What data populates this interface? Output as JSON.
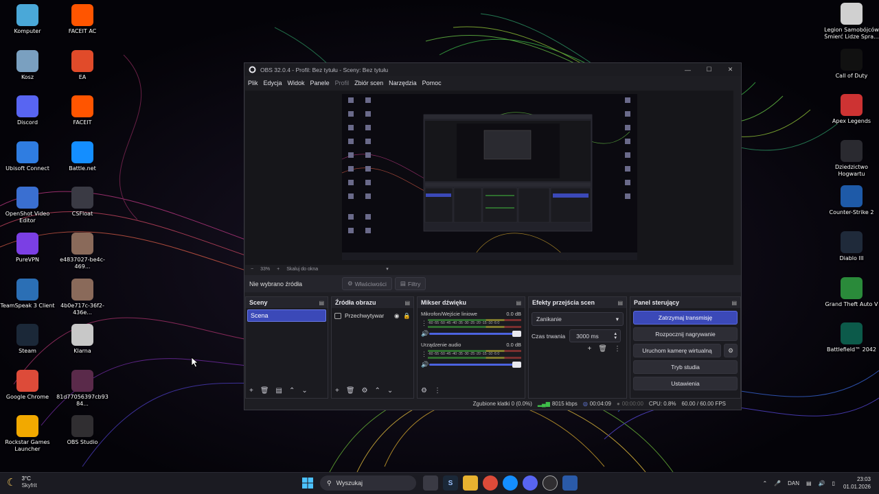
{
  "desktop": {
    "left_icons": [
      {
        "label": "Komputer",
        "icon": "computer-icon",
        "color": "#4aa8d8"
      },
      {
        "label": "FACEIT AC",
        "icon": "faceit-ac-icon",
        "color": "#ff5500"
      },
      {
        "label": "Kosz",
        "icon": "recycle-bin-icon",
        "color": "#7aa0c0"
      },
      {
        "label": "EA",
        "icon": "ea-icon",
        "color": "#e14b2a"
      },
      {
        "label": "Discord",
        "icon": "discord-icon",
        "color": "#5865f2"
      },
      {
        "label": "FACEIT",
        "icon": "faceit-icon",
        "color": "#ff5500"
      },
      {
        "label": "Ubisoft Connect",
        "icon": "ubisoft-icon",
        "color": "#2f7de1"
      },
      {
        "label": "Battle.net",
        "icon": "battlenet-icon",
        "color": "#148eff"
      },
      {
        "label": "OpenShot Video Editor",
        "icon": "openshot-icon",
        "color": "#3a6fd1"
      },
      {
        "label": "CSFloat",
        "icon": "csfloat-icon",
        "color": "#3a3a44"
      },
      {
        "label": "PureVPN",
        "icon": "purevpn-icon",
        "color": "#7b3fe4"
      },
      {
        "label": "e4837027-be4c-469...",
        "icon": "image-file-icon",
        "color": "#8a6a5a"
      },
      {
        "label": "TeamSpeak 3 Client",
        "icon": "teamspeak-icon",
        "color": "#2b6fb5"
      },
      {
        "label": "4b0e717c-36f2-436e...",
        "icon": "image-file-icon",
        "color": "#8a6a5a"
      },
      {
        "label": "Steam",
        "icon": "steam-icon",
        "color": "#1b2838"
      },
      {
        "label": "Klarna",
        "icon": "klarna-file-icon",
        "color": "#c8c8c8"
      },
      {
        "label": "Google Chrome",
        "icon": "chrome-icon",
        "color": "#dd4b39"
      },
      {
        "label": "81d77056397cb9384...",
        "icon": "image-file-icon",
        "color": "#5a2a4a"
      },
      {
        "label": "Rockstar Games Launcher",
        "icon": "rockstar-icon",
        "color": "#f2a900"
      },
      {
        "label": "OBS Studio",
        "icon": "obs-icon",
        "color": "#302e31"
      }
    ],
    "right_icons": [
      {
        "label": "Legion Samobójców Śmierć Lidze Spra...",
        "icon": "legion-icon",
        "color": "#d0d0d0"
      },
      {
        "label": "Call of Duty",
        "icon": "cod-icon",
        "color": "#111111"
      },
      {
        "label": "Apex Legends",
        "icon": "apex-icon",
        "color": "#cd3333"
      },
      {
        "label": "Dziedzictwo Hogwartu",
        "icon": "hogwarts-icon",
        "color": "#2a2a30"
      },
      {
        "label": "Counter-Strike 2",
        "icon": "cs2-icon",
        "color": "#1e5aa8"
      },
      {
        "label": "Diablo III",
        "icon": "diablo-icon",
        "color": "#1f2a3a"
      },
      {
        "label": "Grand Theft Auto V",
        "icon": "gta-icon",
        "color": "#2a8a3a"
      },
      {
        "label": "Battlefield™ 2042",
        "icon": "battlefield-icon",
        "color": "#0c5a4a"
      }
    ]
  },
  "obs": {
    "title": "OBS 32.0.4 - Profil: Bez tytułu - Sceny: Bez tytułu",
    "menu": [
      "Plik",
      "Edycja",
      "Widok",
      "Panele",
      "Profil",
      "Zbiór scen",
      "Narzędzia",
      "Pomoc"
    ],
    "preview_bar": {
      "zoom": "33%",
      "scale": "Skaluj do okna"
    },
    "source_bar": {
      "no_source": "Nie wybrano źródła",
      "properties": "Właściwości",
      "filters": "Filtry"
    },
    "docks": {
      "scenes": {
        "title": "Sceny",
        "items": [
          "Scena"
        ]
      },
      "sources": {
        "title": "Źródła obrazu",
        "items": [
          "Przechwytywar"
        ]
      },
      "mixer": {
        "title": "Mikser dźwięku",
        "scale": "-60 -55 -50 -45 -40 -35 -30 -25 -20 -15 -10 -5 0",
        "channels": [
          {
            "name": "Mikrofon/Wejście liniowe",
            "level": "0.0 dB"
          },
          {
            "name": "Urządzenie audio",
            "level": "0.0 dB"
          }
        ]
      },
      "transitions": {
        "title": "Efekty przejścia scen",
        "selected": "Zanikanie",
        "duration_label": "Czas trwania",
        "duration_value": "3000 ms"
      },
      "controls": {
        "title": "Panel sterujący",
        "stop_stream": "Zatrzymaj transmisję",
        "start_record": "Rozpocznij nagrywanie",
        "virtual_cam": "Uruchom kamerę wirtualną",
        "studio_mode": "Tryb studia",
        "settings": "Ustawienia"
      }
    },
    "status": {
      "dropped": "Zgubione klatki 0 (0.0%)",
      "bitrate": "8015 kbps",
      "stream_time": "00:04:09",
      "record_time": "00:00:00",
      "cpu": "CPU: 0.8%",
      "fps": "60.00 / 60.00 FPS"
    }
  },
  "taskbar": {
    "weather_temp": "3°C",
    "weather_desc": "Skyfrit",
    "search_placeholder": "Wyszukaj",
    "lang": "DAN",
    "time": "23:03",
    "date": "01.01.2026"
  }
}
